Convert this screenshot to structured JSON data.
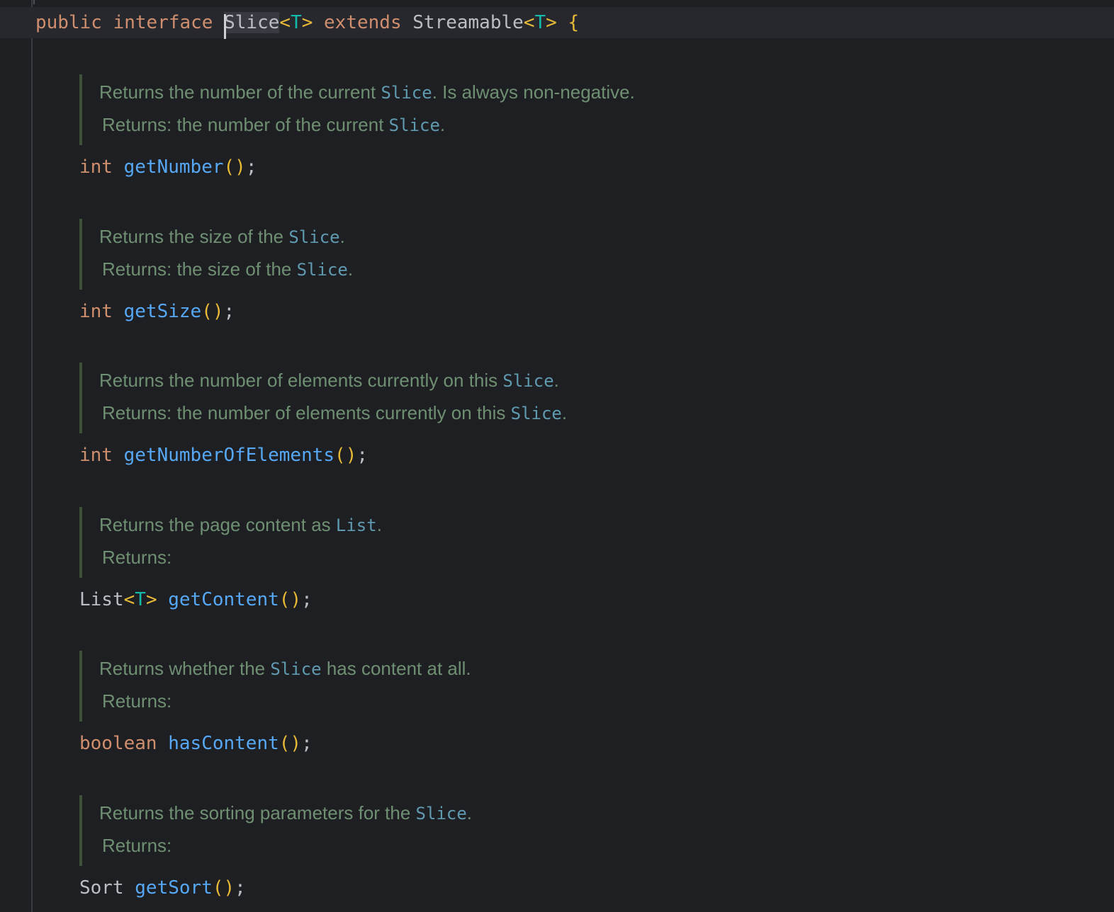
{
  "header": {
    "kw_public": "public",
    "kw_interface": "interface",
    "name_rest": "lice",
    "name_first": "S",
    "type_param": "T",
    "lt": "<",
    "gt": ">",
    "kw_extends": "extends",
    "parent": "Streamable",
    "parent_param": "T",
    "open_brace": "{"
  },
  "methods": [
    {
      "doc": {
        "pre": "Returns the number of the current ",
        "code": "Slice",
        "post": ". Is always non-negative."
      },
      "returns": {
        "label": "Returns: ",
        "pre": "the number of the current ",
        "code": "Slice",
        "post": "."
      },
      "type": "int",
      "name": "getNumber"
    },
    {
      "doc": {
        "pre": "Returns the size of the ",
        "code": "Slice",
        "post": "."
      },
      "returns": {
        "label": "Returns: ",
        "pre": "the size of the ",
        "code": "Slice",
        "post": "."
      },
      "type": "int",
      "name": "getSize"
    },
    {
      "doc": {
        "pre": "Returns the number of elements currently on this ",
        "code": "Slice",
        "post": "."
      },
      "returns": {
        "label": "Returns: ",
        "pre": "the number of elements currently on this ",
        "code": "Slice",
        "post": "."
      },
      "type": "int",
      "name": "getNumberOfElements"
    },
    {
      "doc": {
        "pre": "Returns the page content as ",
        "code": "List",
        "post": "."
      },
      "returns": {
        "label": "Returns:",
        "pre": "",
        "code": "",
        "post": ""
      },
      "type": "List",
      "type_param": "T",
      "name": "getContent"
    },
    {
      "doc": {
        "pre": "Returns whether the ",
        "code": "Slice",
        "post": " has content at all."
      },
      "returns": {
        "label": "Returns:",
        "pre": "",
        "code": "",
        "post": ""
      },
      "type": "boolean",
      "name": "hasContent"
    },
    {
      "doc": {
        "pre": "Returns the sorting parameters for the ",
        "code": "Slice",
        "post": "."
      },
      "returns": {
        "label": "Returns:",
        "pre": "",
        "code": "",
        "post": ""
      },
      "type": "Sort",
      "name": "getSort"
    }
  ],
  "punct": {
    "parens": "()",
    "semicolon": ";"
  },
  "colors": {
    "background": "#1e1f22",
    "keyword": "#cf8e6d",
    "function": "#56a8f5",
    "type_param": "#16baac",
    "bracket": "#e8ba36",
    "doc_text": "#6f8f73",
    "doc_code": "#5f9ab1",
    "doc_bar": "#3d5138"
  }
}
